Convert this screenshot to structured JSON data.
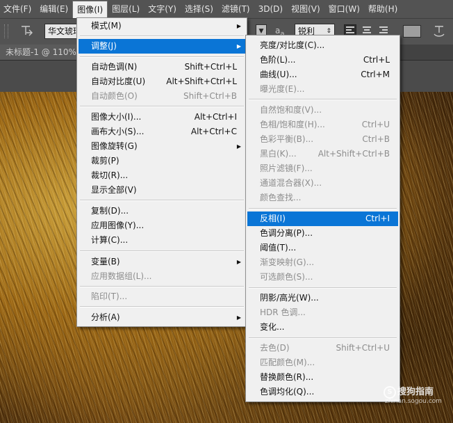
{
  "menubar": [
    {
      "label": "文件(F)"
    },
    {
      "label": "编辑(E)"
    },
    {
      "label": "图像(I)"
    },
    {
      "label": "图层(L)"
    },
    {
      "label": "文字(Y)"
    },
    {
      "label": "选择(S)"
    },
    {
      "label": "滤镜(T)"
    },
    {
      "label": "3D(D)"
    },
    {
      "label": "视图(V)"
    },
    {
      "label": "窗口(W)"
    },
    {
      "label": "帮助(H)"
    }
  ],
  "options": {
    "font_family": "华文琥珀",
    "aa_icon": "a",
    "antialias": "锐利"
  },
  "document_tab": "未标题-1 @ 110%",
  "image_menu": [
    {
      "label": "模式(M)",
      "shortcut": "",
      "submenu": true
    },
    {
      "label": "调整(J)",
      "shortcut": "",
      "submenu": true
    },
    {
      "label": "自动色调(N)",
      "shortcut": "Shift+Ctrl+L"
    },
    {
      "label": "自动对比度(U)",
      "shortcut": "Alt+Shift+Ctrl+L"
    },
    {
      "label": "自动颜色(O)",
      "shortcut": "Shift+Ctrl+B"
    },
    {
      "label": "图像大小(I)...",
      "shortcut": "Alt+Ctrl+I"
    },
    {
      "label": "画布大小(S)...",
      "shortcut": "Alt+Ctrl+C"
    },
    {
      "label": "图像旋转(G)",
      "shortcut": "",
      "submenu": true
    },
    {
      "label": "裁剪(P)",
      "shortcut": ""
    },
    {
      "label": "裁切(R)...",
      "shortcut": ""
    },
    {
      "label": "显示全部(V)",
      "shortcut": ""
    },
    {
      "label": "复制(D)...",
      "shortcut": ""
    },
    {
      "label": "应用图像(Y)...",
      "shortcut": ""
    },
    {
      "label": "计算(C)...",
      "shortcut": ""
    },
    {
      "label": "变量(B)",
      "shortcut": "",
      "submenu": true
    },
    {
      "label": "应用数据组(L)...",
      "shortcut": ""
    },
    {
      "label": "陷印(T)...",
      "shortcut": ""
    },
    {
      "label": "分析(A)",
      "shortcut": "",
      "submenu": true
    }
  ],
  "adjust_menu": [
    {
      "label": "亮度/对比度(C)...",
      "shortcut": ""
    },
    {
      "label": "色阶(L)...",
      "shortcut": "Ctrl+L"
    },
    {
      "label": "曲线(U)...",
      "shortcut": "Ctrl+M"
    },
    {
      "label": "曝光度(E)...",
      "shortcut": ""
    },
    {
      "label": "自然饱和度(V)...",
      "shortcut": ""
    },
    {
      "label": "色相/饱和度(H)...",
      "shortcut": "Ctrl+U"
    },
    {
      "label": "色彩平衡(B)...",
      "shortcut": "Ctrl+B"
    },
    {
      "label": "黑白(K)...",
      "shortcut": "Alt+Shift+Ctrl+B"
    },
    {
      "label": "照片滤镜(F)...",
      "shortcut": ""
    },
    {
      "label": "通道混合器(X)...",
      "shortcut": ""
    },
    {
      "label": "颜色查找...",
      "shortcut": ""
    },
    {
      "label": "反相(I)",
      "shortcut": "Ctrl+I"
    },
    {
      "label": "色调分离(P)...",
      "shortcut": ""
    },
    {
      "label": "阈值(T)...",
      "shortcut": ""
    },
    {
      "label": "渐变映射(G)...",
      "shortcut": ""
    },
    {
      "label": "可选颜色(S)...",
      "shortcut": ""
    },
    {
      "label": "阴影/高光(W)...",
      "shortcut": ""
    },
    {
      "label": "HDR 色调...",
      "shortcut": ""
    },
    {
      "label": "变化...",
      "shortcut": ""
    },
    {
      "label": "去色(D)",
      "shortcut": "Shift+Ctrl+U"
    },
    {
      "label": "匹配颜色(M)...",
      "shortcut": ""
    },
    {
      "label": "替换颜色(R)...",
      "shortcut": ""
    },
    {
      "label": "色调均化(Q)...",
      "shortcut": ""
    }
  ],
  "watermark": {
    "icon_glyph": "S",
    "text": "搜狗指南",
    "url": "zhinan.sogou.com"
  },
  "colors": {
    "highlight": "#0a75d6",
    "menu_bg": "#f0f0f0",
    "chrome": "#535353"
  }
}
